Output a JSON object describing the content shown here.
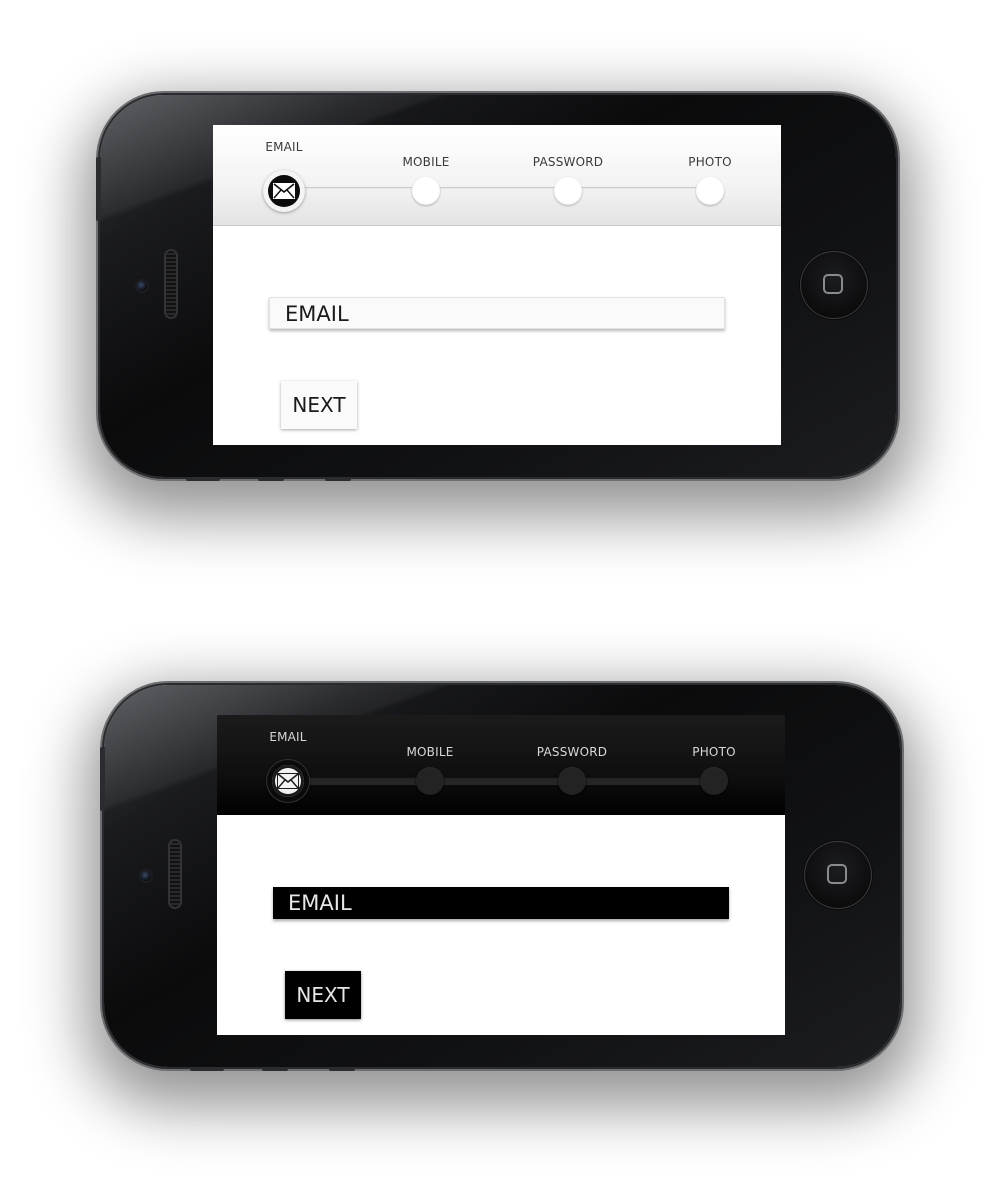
{
  "variants": [
    {
      "theme": "light",
      "steps": [
        {
          "label": "EMAIL",
          "icon": "envelope-icon",
          "active": true
        },
        {
          "label": "MOBILE",
          "active": false
        },
        {
          "label": "PASSWORD",
          "active": false
        },
        {
          "label": "PHOTO",
          "active": false
        }
      ],
      "email_field": {
        "text": "EMAIL"
      },
      "next_label": "NEXT",
      "colors": {
        "accent": "#0c0c0c",
        "bar": "#f3f3f3"
      }
    },
    {
      "theme": "dark",
      "steps": [
        {
          "label": "EMAIL",
          "icon": "envelope-icon",
          "active": true
        },
        {
          "label": "MOBILE",
          "active": false
        },
        {
          "label": "PASSWORD",
          "active": false
        },
        {
          "label": "PHOTO",
          "active": false
        }
      ],
      "email_field": {
        "text": "EMAIL"
      },
      "next_label": "NEXT",
      "colors": {
        "accent": "#f2f2f2",
        "bar": "#0f0f0f"
      }
    }
  ]
}
